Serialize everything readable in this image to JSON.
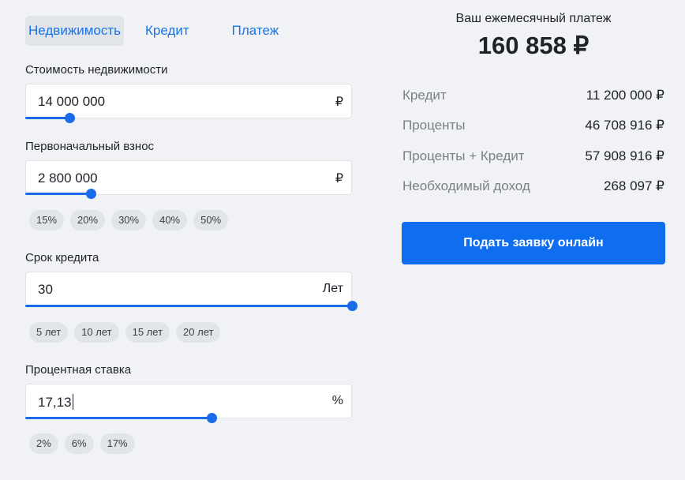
{
  "tabs": [
    {
      "label": "Недвижимость",
      "active": true
    },
    {
      "label": "Кредит",
      "active": false
    },
    {
      "label": "Платеж",
      "active": false
    }
  ],
  "property_cost": {
    "label": "Стоимость недвижимости",
    "value": "14 000 000",
    "unit": "₽",
    "slider_fraction": 0.135
  },
  "down_payment": {
    "label": "Первоначальный взнос",
    "value": "2 800 000",
    "unit": "₽",
    "slider_fraction": 0.2,
    "presets": [
      "15%",
      "20%",
      "30%",
      "40%",
      "50%"
    ]
  },
  "term": {
    "label": "Срок кредита",
    "value": "30",
    "unit": "Лет",
    "slider_fraction": 1.0,
    "presets": [
      "5 лет",
      "10 лет",
      "15 лет",
      "20 лет"
    ]
  },
  "rate": {
    "label": "Процентная ставка",
    "value": "17,13",
    "unit": "%",
    "slider_fraction": 0.57,
    "presets": [
      "2%",
      "6%",
      "17%"
    ]
  },
  "summary": {
    "title": "Ваш ежемесячный платеж",
    "amount": "160 858 ₽",
    "rows": [
      {
        "label": "Кредит",
        "value": "11 200 000 ₽"
      },
      {
        "label": "Проценты",
        "value": "46 708 916 ₽"
      },
      {
        "label": "Проценты + Кредит",
        "value": "57 908 916 ₽"
      },
      {
        "label": "Необходимый доход",
        "value": "268 097 ₽"
      }
    ],
    "apply_label": "Подать заявку онлайн"
  },
  "colors": {
    "accent": "#1a6bea",
    "button": "#0f6ef0",
    "background": "#f0f2f5"
  }
}
